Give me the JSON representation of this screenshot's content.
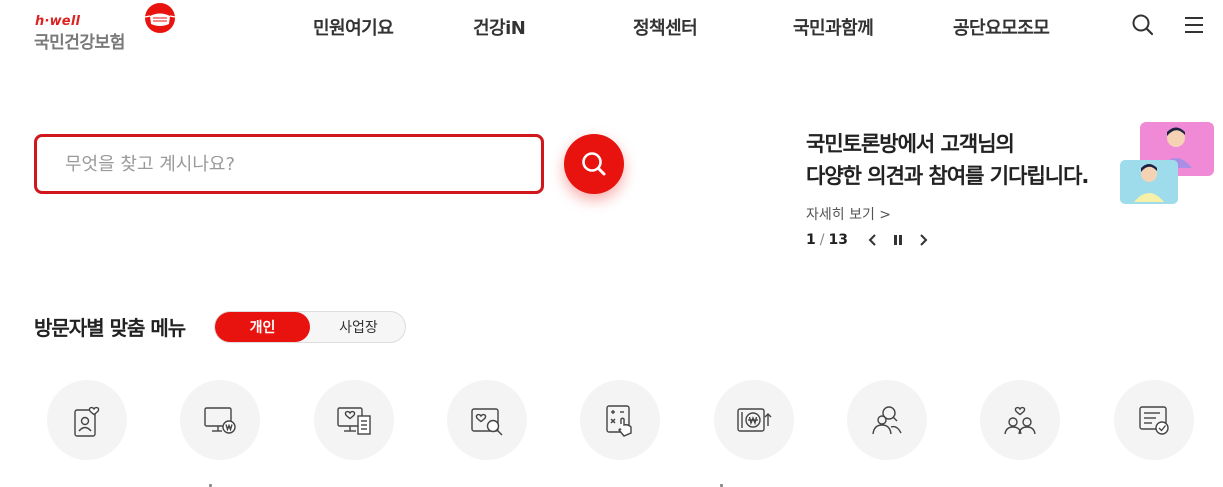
{
  "header": {
    "logo_tagline": "h·well",
    "logo_name": "국민건강보험",
    "nav": [
      "민원여기요",
      "건강iN",
      "정책센터",
      "국민과함께",
      "공단요모조모"
    ],
    "search_icon": "search-icon",
    "menu_icon": "hamburger-menu-icon"
  },
  "search": {
    "placeholder": "무엇을 찾고 계시나요?",
    "value": ""
  },
  "banner": {
    "title_line1": "국민토론방에서 고객님의",
    "title_line2": "다양한 의견과 참여를 기다립니다.",
    "link": "자세히 보기 >",
    "page_current": "1",
    "page_separator": "/",
    "page_total": "13"
  },
  "visitor_menu": {
    "title": "방문자별 맞춤 메뉴",
    "tabs": [
      "개인",
      "사업장"
    ],
    "active_tab": "개인",
    "icons": [
      "profile-heart-icon",
      "monitor-won-icon",
      "receipt-heart-icon",
      "search-heart-icon",
      "calculator-hand-icon",
      "won-up-icon",
      "person-search-icon",
      "family-heart-icon",
      "document-check-icon"
    ]
  },
  "colors": {
    "brand_red": "#e8130f",
    "border_red": "#d0181c",
    "text_dark": "#222222",
    "icon_bg": "#f4f4f4"
  }
}
